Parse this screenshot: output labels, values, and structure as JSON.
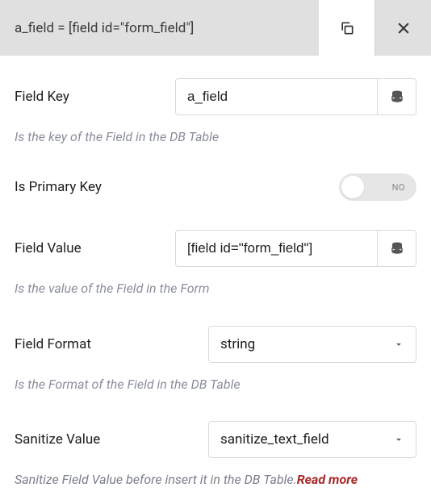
{
  "header": {
    "title": "a_field = [field id=\"form_field\"]"
  },
  "fields": {
    "field_key": {
      "label": "Field Key",
      "value": "a_field",
      "help": "Is the key of the Field in the DB Table"
    },
    "is_primary_key": {
      "label": "Is Primary Key",
      "value": false,
      "off_label": "NO"
    },
    "field_value": {
      "label": "Field Value",
      "value": "[field id=\"form_field\"]",
      "help": "Is the value of the Field in the Form"
    },
    "field_format": {
      "label": "Field Format",
      "value": "string",
      "help": "Is the Format of the Field in the DB Table"
    },
    "sanitize_value": {
      "label": "Sanitize Value",
      "value": "sanitize_text_field",
      "help": "Sanitize Field Value before insert it in the DB Table.",
      "read_more": "Read more"
    }
  }
}
